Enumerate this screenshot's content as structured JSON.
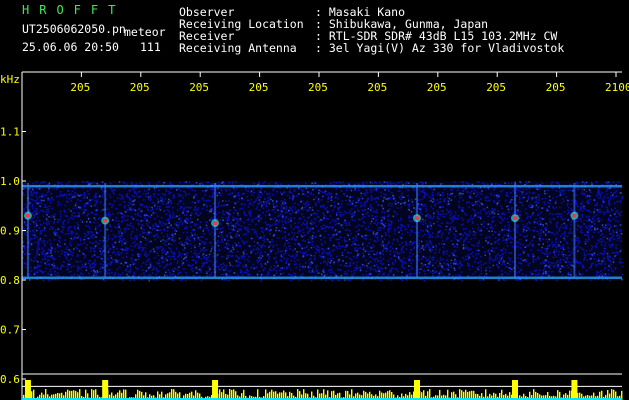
{
  "header": {
    "brand": "HROFFT",
    "file_name": "UT2506062050.pn",
    "file_tag": "meteor",
    "timestamp": "25.06.06 20:50",
    "count": "111",
    "fields": [
      {
        "label": "Observer",
        "value": ": Masaki Kano"
      },
      {
        "label": "Receiving Location",
        "value": ": Shibukawa, Gunma, Japan"
      },
      {
        "label": "Receiver",
        "value": ": RTL-SDR SDR# 43dB L15 103.2MHz CW"
      },
      {
        "label": "Receiving Antenna",
        "value": ": 3el Yagi(V) Az 330 for Vladivostok"
      }
    ]
  },
  "colors": {
    "text": "#ffffff",
    "accent": "#ffff00",
    "brand": "#33ee55",
    "noise": "#0a12c8",
    "background": "#000000"
  },
  "chart_data": {
    "type": "heatmap",
    "ylabel": "kHz",
    "ylim": [
      0.58,
      1.15
    ],
    "y_ticks": [
      "1.1",
      "1.0",
      "0.9",
      "0.8",
      "0.7",
      "0.6"
    ],
    "y_tick_values": [
      1.1,
      1.0,
      0.9,
      0.8,
      0.7,
      0.6
    ],
    "x_ticks": [
      "205",
      "205",
      "205",
      "205",
      "205",
      "205",
      "205",
      "205",
      "205",
      "2100"
    ],
    "x_tick_minutes": [
      0,
      1,
      2,
      3,
      4,
      5,
      6,
      7,
      8,
      9,
      10
    ],
    "band_khz": [
      0.8,
      1.0
    ],
    "band_edges": [
      {
        "name": "upper edge",
        "khz": 0.99
      },
      {
        "name": "lower edge",
        "khz": 0.805
      }
    ],
    "meteor_echoes": [
      {
        "minute": 0.1,
        "khz": 0.93
      },
      {
        "minute": 1.4,
        "khz": 0.92
      },
      {
        "minute": 3.25,
        "khz": 0.915
      },
      {
        "minute": 6.65,
        "khz": 0.925
      },
      {
        "minute": 8.3,
        "khz": 0.925
      },
      {
        "minute": 9.3,
        "khz": 0.93
      }
    ]
  }
}
